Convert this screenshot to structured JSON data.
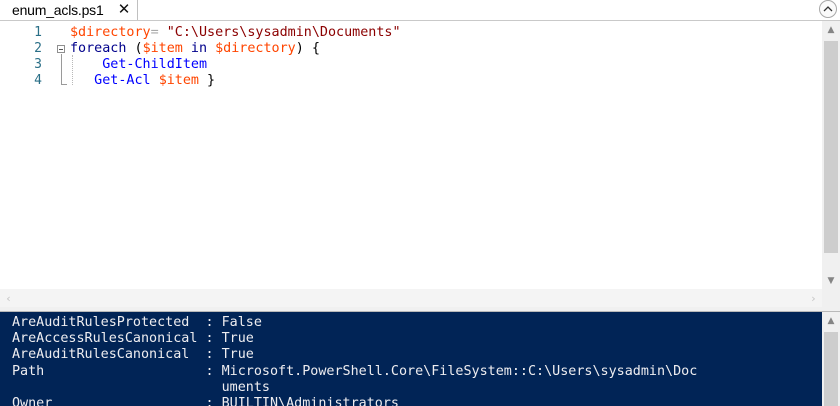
{
  "tab": {
    "label": "enum_acls.ps1",
    "close_glyph": "✕"
  },
  "collapse_icon": "chevron-up-icon",
  "editor": {
    "line_numbers": [
      "1",
      "2",
      "3",
      "4"
    ],
    "lines": [
      [
        {
          "t": "$directory",
          "c": "var"
        },
        {
          "t": "= ",
          "c": "op"
        },
        {
          "t": "\"C:\\Users\\sysadmin\\Documents\"",
          "c": "str"
        }
      ],
      [
        {
          "t": "foreach",
          "c": "kw"
        },
        {
          "t": " (",
          "c": "pl"
        },
        {
          "t": "$item",
          "c": "var"
        },
        {
          "t": " in ",
          "c": "kw"
        },
        {
          "t": "$directory",
          "c": "var"
        },
        {
          "t": ") {",
          "c": "pl"
        }
      ],
      [
        {
          "t": "    Get-ChildItem",
          "c": "cmd"
        }
      ],
      [
        {
          "t": "   Get-Acl",
          "c": "cmd"
        },
        {
          "t": " ",
          "c": "pl"
        },
        {
          "t": "$item",
          "c": "var"
        },
        {
          "t": " }",
          "c": "pl"
        }
      ]
    ]
  },
  "scrollbars": {
    "up_glyph": "▲",
    "down_glyph": "▼",
    "left_glyph": "‹",
    "right_glyph": "›"
  },
  "console": {
    "lines": [
      "AreAuditRulesProtected  : False",
      "AreAccessRulesCanonical : True",
      "AreAuditRulesCanonical  : True",
      "Path                    : Microsoft.PowerShell.Core\\FileSystem::C:\\Users\\sysadmin\\Doc",
      "                          uments",
      "Owner                   : BUILTIN\\Administrators"
    ]
  },
  "colors": {
    "console_bg": "#012456",
    "console_fg": "#eeedf0",
    "variable": "#ff4500",
    "string": "#8b0000",
    "keyword": "#00008b",
    "command": "#0000ff",
    "line_number": "#2a6f87"
  }
}
